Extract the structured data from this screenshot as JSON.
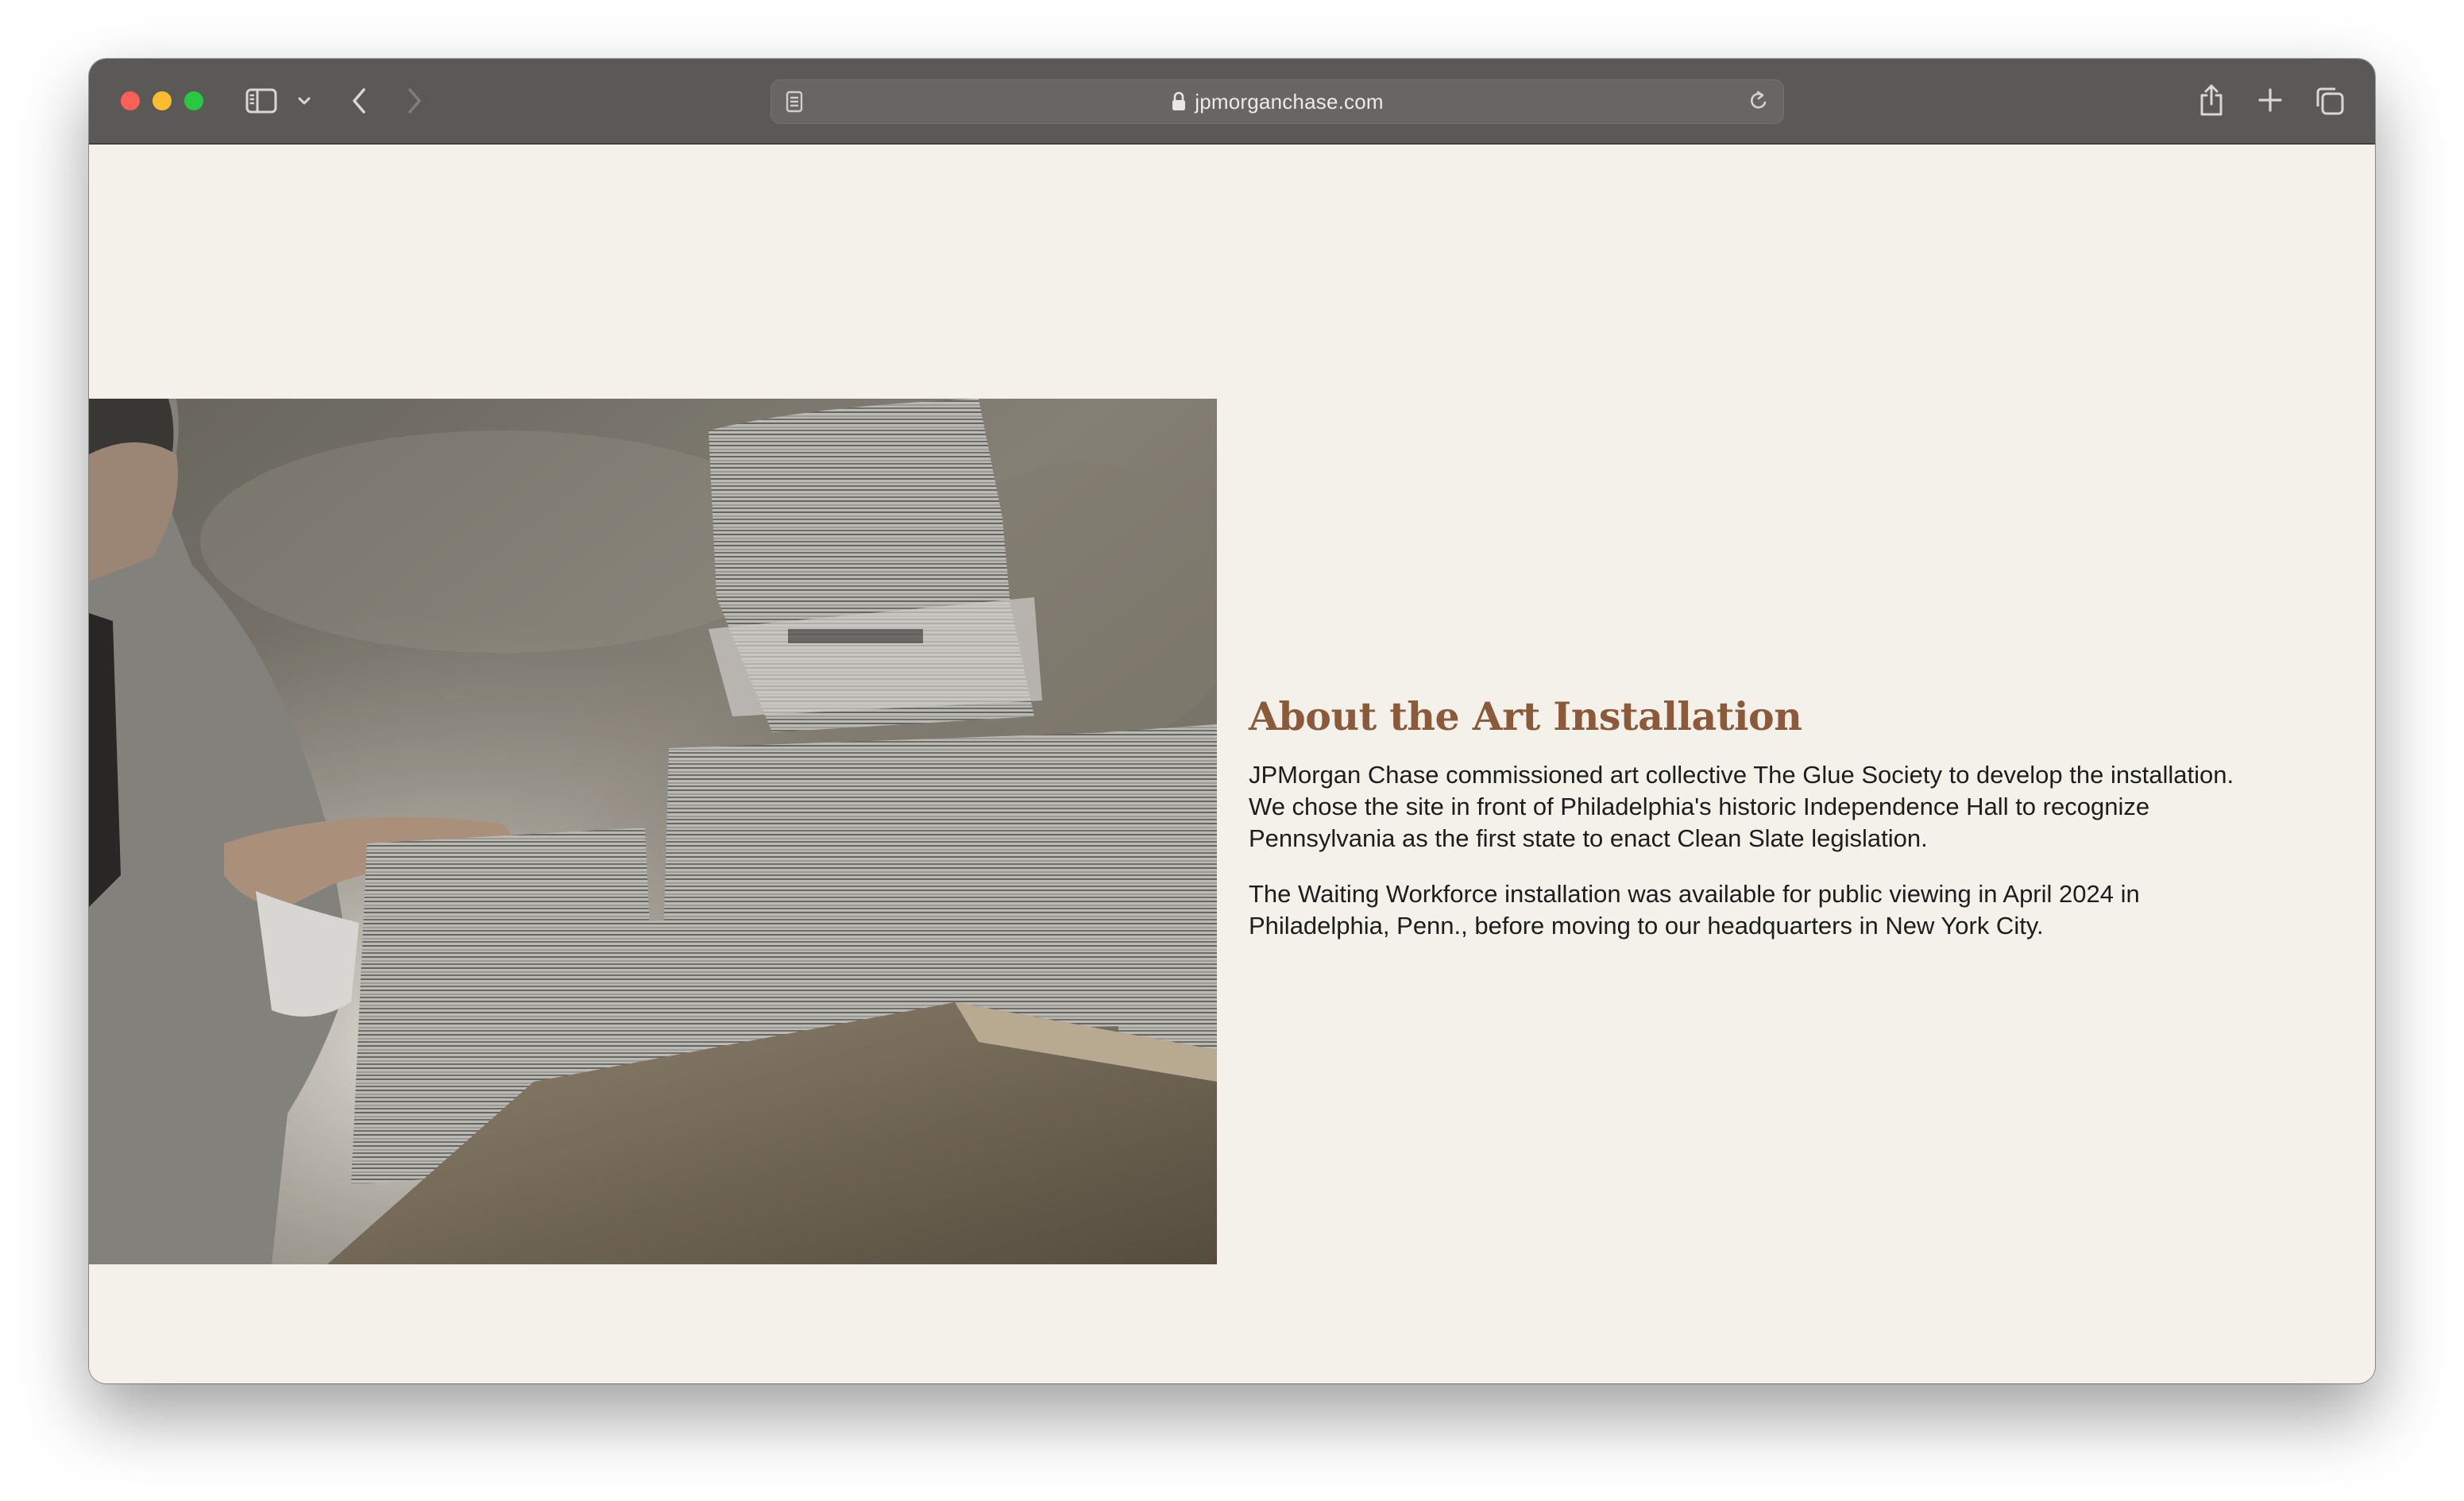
{
  "browser": {
    "url": "jpmorganchase.com",
    "colors": {
      "toolbar": "#5a5957",
      "close": "#fe5f57",
      "minimize": "#febc2e",
      "maximize": "#28c840"
    },
    "icons": [
      "sidebar-icon",
      "chevron-down-icon",
      "back-icon",
      "forward-icon",
      "reader-icon",
      "lock-icon",
      "reload-icon",
      "share-icon",
      "plus-icon",
      "tabs-icon"
    ]
  },
  "page": {
    "background": "#f4f1eb",
    "heading": "About the Art Installation",
    "heading_color": "#8a5a3a",
    "paragraphs": [
      "JPMorgan Chase commissioned art collective The Glue Society to develop the installation. We chose the site in front of Philadelphia's historic Independence Hall to recognize Pennsylvania as the first state to enact Clean Slate legislation.",
      "The Waiting Workforce installation was available for public viewing in April 2024 in Philadelphia, Penn., before moving to our headquarters in New York City."
    ]
  }
}
